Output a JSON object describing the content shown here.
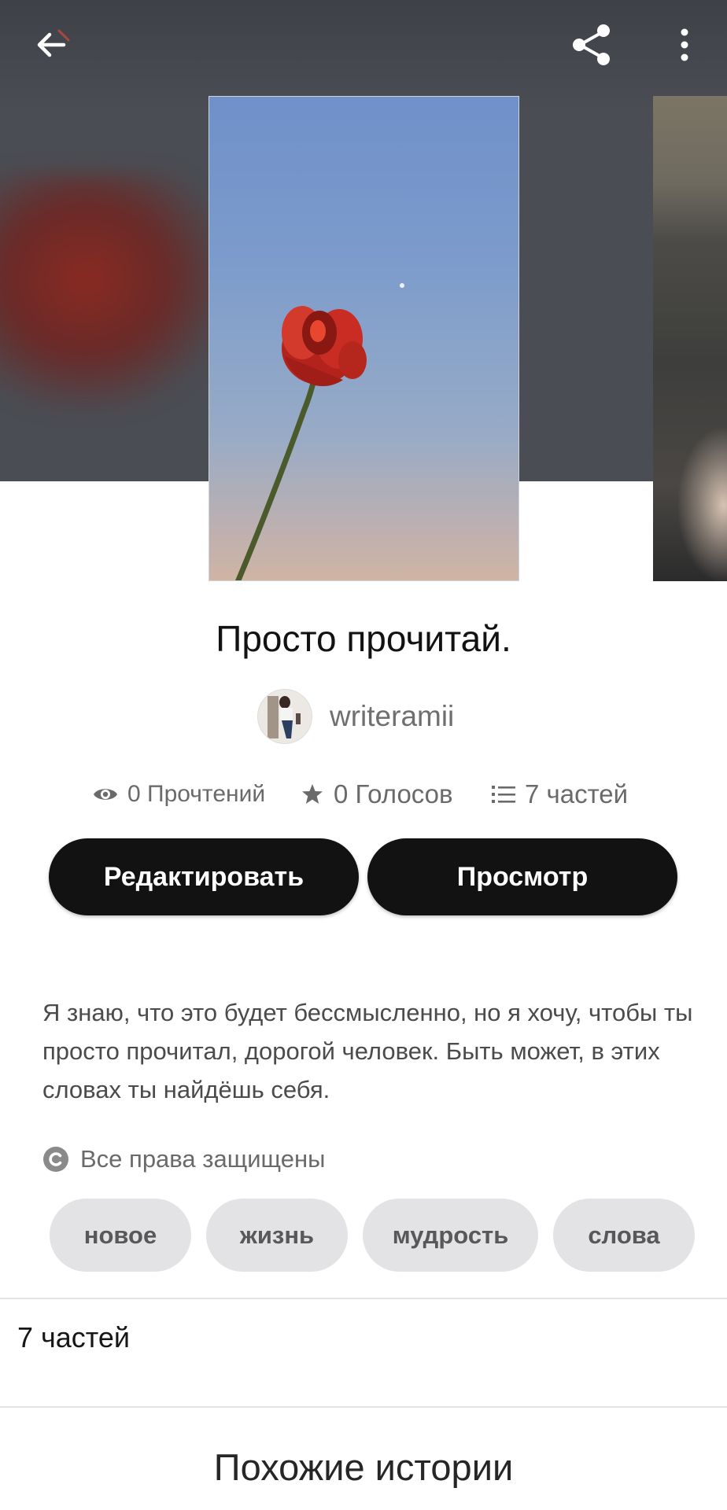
{
  "header": {
    "back_icon": "arrow-left-icon",
    "share_icon": "share-icon",
    "more_icon": "more-vertical-icon"
  },
  "story": {
    "title": "Просто прочитай.",
    "author": "writeramii",
    "stats": {
      "reads": "0 Прочтений",
      "votes": "0 Голосов",
      "parts": "7 частей"
    },
    "edit_label": "Редактировать",
    "preview_label": "Просмотр",
    "description": "Я знаю, что это будет бессмысленно, но я хочу, чтобы ты просто прочитал, дорогой человек. Быть может, в этих словах ты найдёшь себя.",
    "copyright": "Все права защищены",
    "tags": [
      "новое",
      "жизнь",
      "мудрость",
      "слова"
    ]
  },
  "sections": {
    "parts_label": "7 частей",
    "similar_title": "Похожие истории"
  },
  "colors": {
    "hero_bg": "#4a4d53",
    "button_bg": "#121212",
    "tag_bg": "#e3e3e5"
  }
}
